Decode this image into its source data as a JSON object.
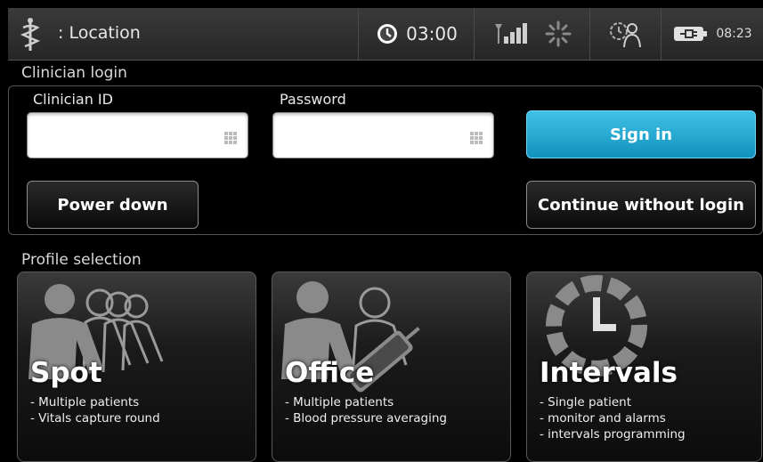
{
  "status_bar": {
    "location_label": ": Location",
    "timer": "03:00",
    "clock": "08:23"
  },
  "login": {
    "section_title": "Clinician login",
    "clinician_id_label": "Clinician ID",
    "clinician_id_value": "",
    "password_label": "Password",
    "password_value": "",
    "sign_in": "Sign in",
    "power_down": "Power down",
    "continue_without_login": "Continue without login"
  },
  "profiles": {
    "section_title": "Profile selection",
    "cards": [
      {
        "title": "Spot",
        "lines": [
          "- Multiple patients",
          "- Vitals capture round"
        ]
      },
      {
        "title": "Office",
        "lines": [
          "- Multiple patients",
          "- Blood pressure averaging"
        ]
      },
      {
        "title": "Intervals",
        "lines": [
          "- Single patient",
          "- monitor and alarms",
          "- intervals programming"
        ]
      }
    ]
  },
  "colors": {
    "accent": "#1aa6d2",
    "background": "#000000",
    "status_bar": "#303030"
  }
}
